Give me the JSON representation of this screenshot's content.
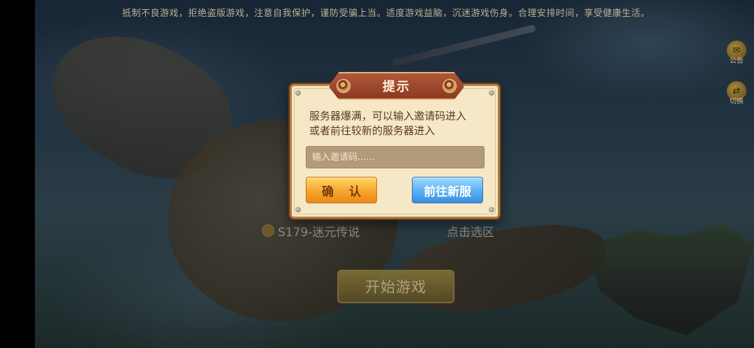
{
  "top_notice": "抵制不良游戏，拒绝盗版游戏，注意自我保护，谨防受骗上当。适度游戏益脑，沉迷游戏伤身。合理安排时间，享受健康生活。",
  "side_buttons": [
    {
      "label": "公告",
      "icon": "announcement-icon"
    },
    {
      "label": "切换",
      "icon": "switch-account-icon"
    }
  ],
  "server": {
    "name": "S179-迷元传说",
    "select_label": "点击选区"
  },
  "start_button": "开始游戏",
  "dialog": {
    "title": "提示",
    "message_line1": "服务器爆满，可以输入邀请码进入",
    "message_line2": "或者前往较新的服务器进入",
    "input_placeholder": "输入邀请码......",
    "input_value": "",
    "confirm_label": "确 认",
    "new_server_label": "前往新服"
  },
  "colors": {
    "dialog_bg": "#f6e8c6",
    "title_plate": "#9c4a2e",
    "confirm_button": "#f7a52a",
    "new_server_button": "#59aef3"
  }
}
